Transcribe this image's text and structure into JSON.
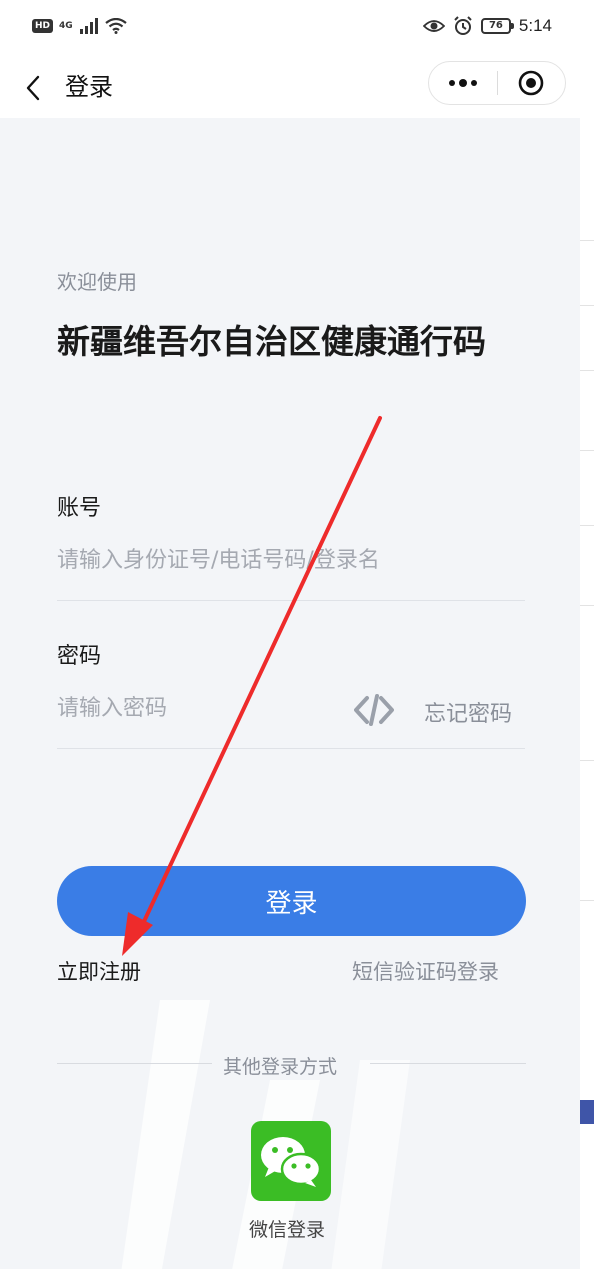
{
  "status_bar": {
    "hd": "HD",
    "network": "4G",
    "battery": "76",
    "time": "5:14"
  },
  "nav": {
    "title": "登录"
  },
  "login": {
    "welcome": "欢迎使用",
    "title": "新疆维吾尔自治区健康通行码",
    "account_label": "账号",
    "account_placeholder": "请输入身份证号/电话号码/登录名",
    "password_label": "密码",
    "password_placeholder": "请输入密码",
    "forgot_password": "忘记密码",
    "login_button": "登录",
    "register": "立即注册",
    "sms_login": "短信验证码登录",
    "other_methods": "其他登录方式",
    "wechat_login": "微信登录"
  },
  "colors": {
    "primary": "#3a7de6",
    "wechat": "#3bbd25",
    "annotation": "#ee2b2b"
  }
}
